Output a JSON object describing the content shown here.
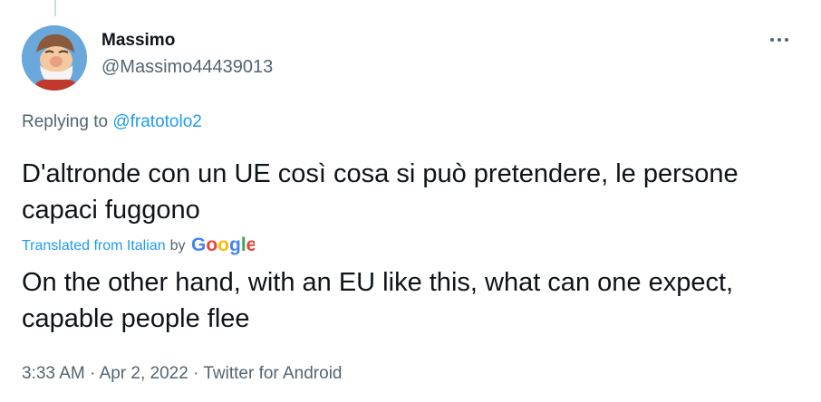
{
  "author": {
    "display_name": "Massimo",
    "handle": "@Massimo44439013"
  },
  "reply": {
    "prefix": "Replying to",
    "mention": "@fratotolo2"
  },
  "tweet": {
    "text": "D'altronde con un UE così cosa si può pretendere, le persone capaci fuggono"
  },
  "translation": {
    "label": "Translated from Italian",
    "by": "by",
    "provider": "Google",
    "text": "On the other hand, with an EU like this, what can one expect, capable people flee"
  },
  "meta": {
    "time": "3:33 AM",
    "separator": "·",
    "date": "Apr 2, 2022",
    "source": "Twitter for Android"
  },
  "colors": {
    "link_blue": "#1d9bf0",
    "secondary_text": "#536471",
    "primary_text": "#0f1419",
    "google_blue": "#4285F4",
    "google_red": "#EA4335",
    "google_yellow": "#FBBC05",
    "google_green": "#34A853"
  },
  "icons": {
    "more": "more-horizontal-icon",
    "avatar": "avatar-image"
  }
}
